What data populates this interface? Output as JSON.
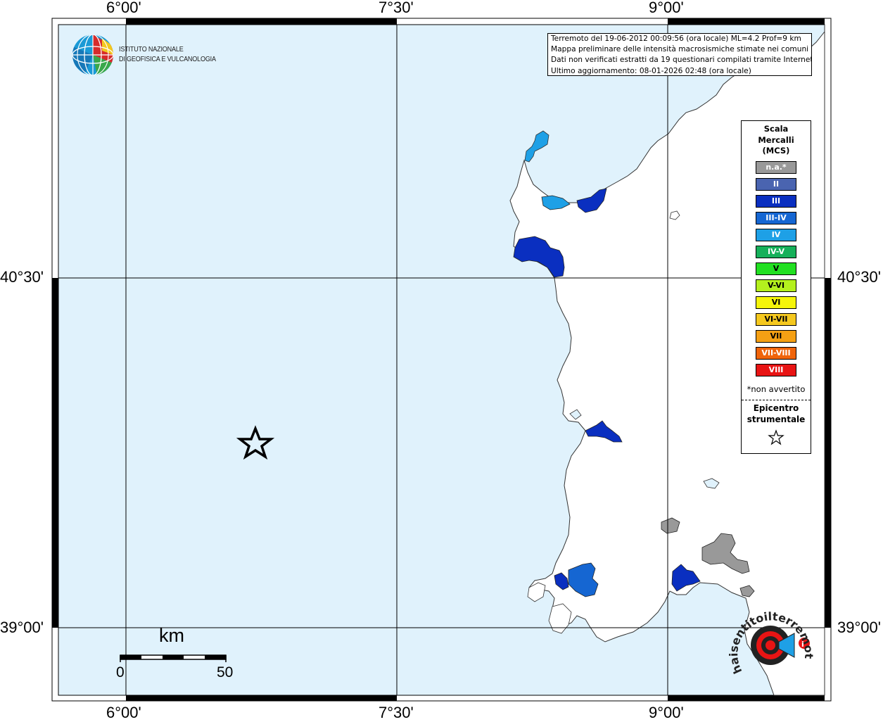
{
  "map": {
    "lon_labels": [
      "6°00'",
      "7°30'",
      "9°00'"
    ],
    "lat_labels": [
      "40°30'",
      "39°00'"
    ],
    "sea_color": "#e0f2fc",
    "land_color": "#ffffff"
  },
  "info": {
    "lines": [
      "Terremoto del 19-06-2012 00:09:56 (ora locale) ML=4.2 Prof=9 km",
      "Mappa preliminare delle intensità macrosismiche stimate nei comuni",
      "Dati non verificati estratti da 19 questionari compilati tramite Internet.",
      "Ultimo aggiornamento: 08-01-2026 02:48 (ora locale)"
    ]
  },
  "logo": {
    "line1": "ISTITUTO NAZIONALE",
    "line2": "DI GEOFISICA E VULCANOLOGIA",
    "icon": "globe-logo-icon"
  },
  "legend": {
    "title1": "Scala",
    "title2": "Mercalli",
    "title3": "(MCS)",
    "items": [
      {
        "label": "n.a.*",
        "color": "#999999"
      },
      {
        "label": "II",
        "color": "#4a64b0"
      },
      {
        "label": "III",
        "color": "#0a2fc0"
      },
      {
        "label": "III-IV",
        "color": "#1566d2"
      },
      {
        "label": "IV",
        "color": "#1ea0e6"
      },
      {
        "label": "IV-V",
        "color": "#16b05a"
      },
      {
        "label": "V",
        "color": "#22e022"
      },
      {
        "label": "V-VI",
        "color": "#b4f01e"
      },
      {
        "label": "VI",
        "color": "#f5f50a"
      },
      {
        "label": "VI-VII",
        "color": "#f5c81e"
      },
      {
        "label": "VII",
        "color": "#f5a014"
      },
      {
        "label": "VII-VIII",
        "color": "#f0640a"
      },
      {
        "label": "VIII",
        "color": "#e81414"
      }
    ],
    "note": "*non avvertito",
    "epi1": "Epicentro",
    "epi2": "strumentale",
    "epi_icon": "star-icon"
  },
  "scalebar": {
    "unit": "km",
    "start": "0",
    "end": "50"
  },
  "watermark": {
    "text": "haisentitoilterremoto.it",
    "icon": "hsit-logo-icon"
  }
}
